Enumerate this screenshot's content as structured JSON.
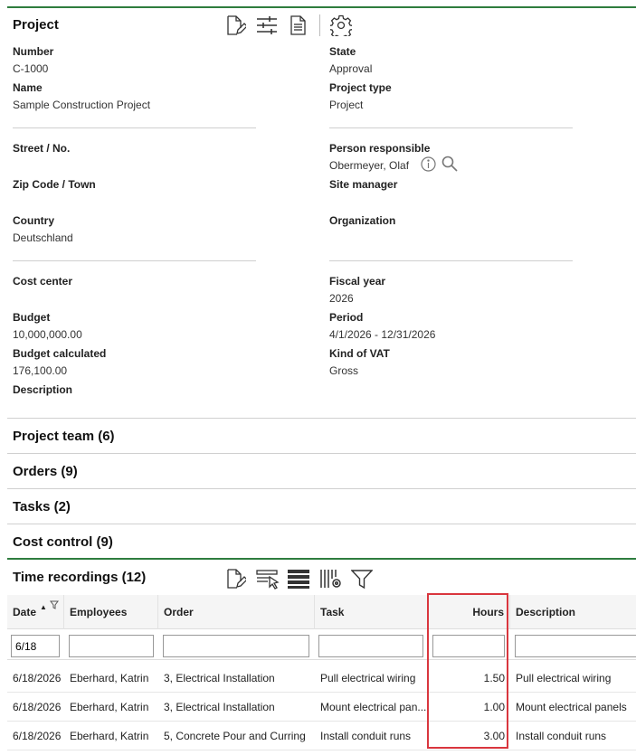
{
  "project": {
    "title": "Project",
    "fields_left": [
      {
        "label": "Number",
        "value": "C-1000"
      },
      {
        "label": "Name",
        "value": "Sample Construction Project"
      },
      {
        "label": "Street / No.",
        "value": ""
      },
      {
        "label": "Zip Code / Town",
        "value": ""
      },
      {
        "label": "Country",
        "value": "Deutschland"
      },
      {
        "label": "Cost center",
        "value": ""
      },
      {
        "label": "Budget",
        "value": "10,000,000.00"
      },
      {
        "label": "Budget calculated",
        "value": "176,100.00"
      },
      {
        "label": "Description",
        "value": ""
      }
    ],
    "fields_right": [
      {
        "label": "State",
        "value": "Approval"
      },
      {
        "label": "Project type",
        "value": "Project"
      },
      {
        "label": "Person responsible",
        "value": "Obermeyer, Olaf"
      },
      {
        "label": "Site manager",
        "value": ""
      },
      {
        "label": "Organization",
        "value": ""
      },
      {
        "label": "Fiscal year",
        "value": "2026"
      },
      {
        "label": "Period",
        "value": "4/1/2026 - 12/31/2026"
      },
      {
        "label": "Kind of VAT",
        "value": "Gross"
      }
    ],
    "toolbar_icons": [
      "edit-document-icon",
      "settings-sliders-icon",
      "document-icon",
      "gear-icon"
    ]
  },
  "sections": {
    "project_team": "Project team (6)",
    "orders": "Orders (9)",
    "tasks": "Tasks (2)",
    "cost_control": "Cost control (9)",
    "time_recordings": "Time recordings (12)"
  },
  "time_recordings": {
    "toolbar_icons": [
      "edit-document-icon",
      "select-rows-icon",
      "rows-icon",
      "columns-settings-icon",
      "filter-icon"
    ],
    "columns": [
      "Date",
      "Employees",
      "Order",
      "Task",
      "Hours",
      "Description"
    ],
    "filters": [
      "6/18",
      "",
      "",
      "",
      "",
      ""
    ],
    "rows": [
      [
        "6/18/2026",
        "Eberhard, Katrin",
        "3, Electrical Installation",
        "Pull electrical wiring",
        "1.50",
        "Pull electrical wiring"
      ],
      [
        "6/18/2026",
        "Eberhard, Katrin",
        "3, Electrical Installation",
        "Mount electrical pan...",
        "1.00",
        "Mount electrical panels"
      ],
      [
        "6/18/2026",
        "Eberhard, Katrin",
        "5, Concrete Pour and Curring",
        "Install conduit runs",
        "3.00",
        "Install conduit runs"
      ]
    ]
  },
  "colors": {
    "accent": "#2e7d3e",
    "highlight": "#d9363e"
  }
}
